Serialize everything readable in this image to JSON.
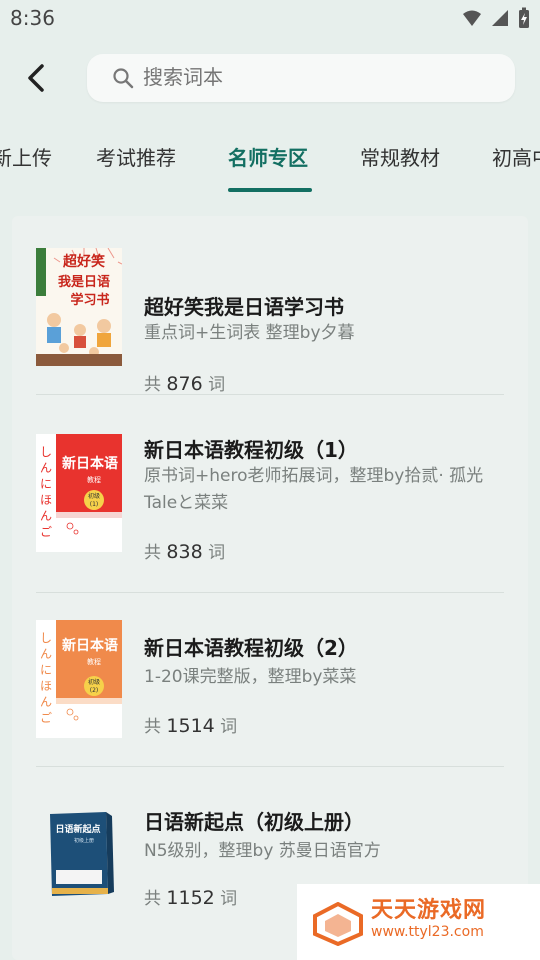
{
  "status": {
    "time": "8:36"
  },
  "search": {
    "placeholder": "搜索词本"
  },
  "tabs": [
    {
      "label": "新上传"
    },
    {
      "label": "考试推荐"
    },
    {
      "label": "名师专区"
    },
    {
      "label": "常规教材"
    },
    {
      "label": "初高中"
    }
  ],
  "books": [
    {
      "title": "超好笑我是日语学习书",
      "desc": "重点词+生词表 整理by夕暮",
      "count_prefix": "共",
      "count": "876",
      "count_suffix": "词",
      "cover": {
        "text": "超好笑我是日语学习书",
        "side_text": "日语学习书"
      }
    },
    {
      "title": "新日本语教程初级（1）",
      "desc": "原书词+hero老师拓展词，整理by拾贰· 孤光Taleと菜菜",
      "count_prefix": "共",
      "count": "838",
      "count_suffix": "词",
      "cover": {
        "text": "新日本语",
        "sub": "教程",
        "badge": "初级（1）",
        "side_text": "しんにほんご",
        "color": "#e8332e"
      }
    },
    {
      "title": "新日本语教程初级（2）",
      "desc": "1-20课完整版，整理by菜菜",
      "count_prefix": "共",
      "count": "1514",
      "count_suffix": "词",
      "cover": {
        "text": "新日本语",
        "sub": "教程",
        "badge": "初级（2）",
        "side_text": "しんにほんご",
        "color": "#f08a4b"
      }
    },
    {
      "title": "日语新起点（初级上册）",
      "desc": "N5级别，整理by 苏曼日语官方",
      "count_prefix": "共",
      "count": "1152",
      "count_suffix": "词",
      "cover": {
        "text": "日语新起点",
        "color": "#1d4f78"
      }
    }
  ],
  "watermark": {
    "text": "天天游戏网",
    "url": "www.ttyl23.com"
  },
  "colors": {
    "accent": "#136f62",
    "background": "#e7efec"
  }
}
